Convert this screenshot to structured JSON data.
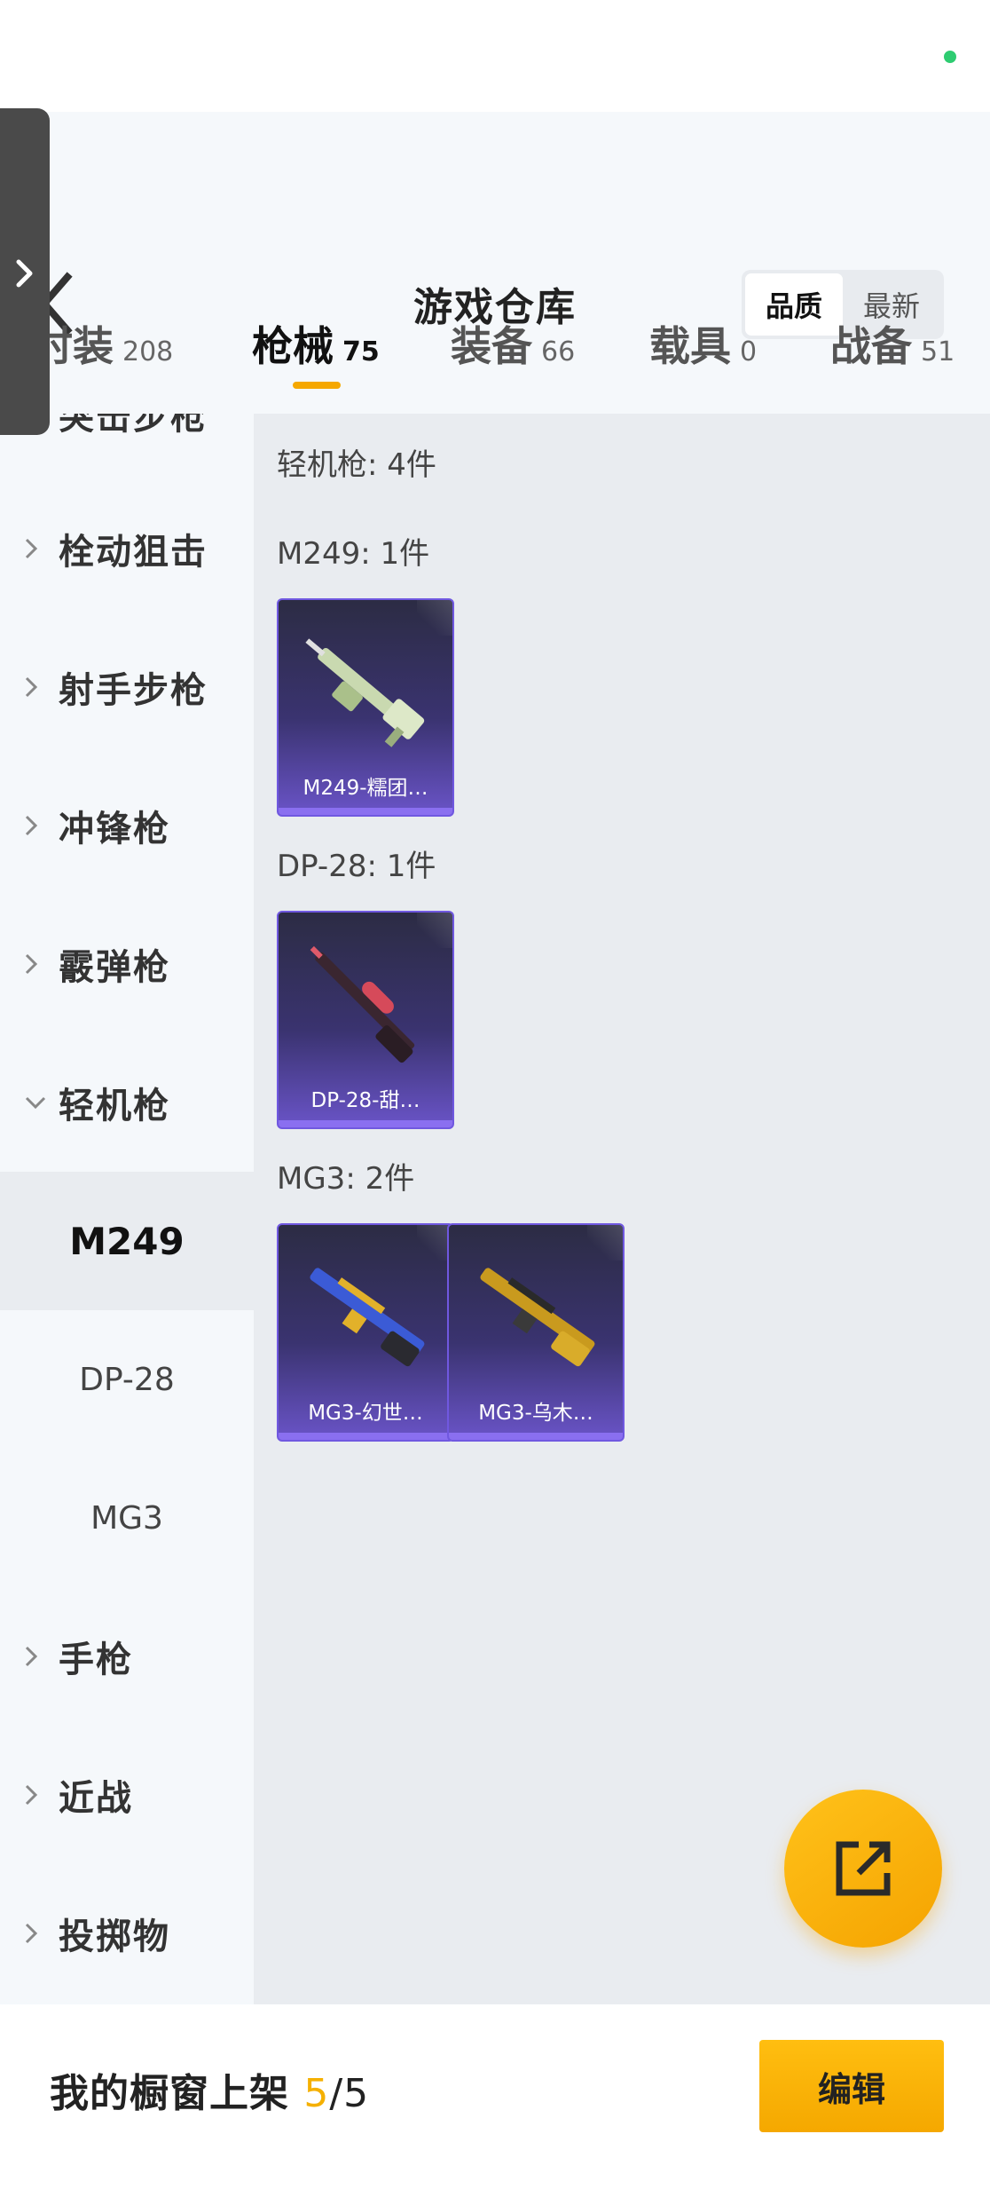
{
  "header": {
    "title": "游戏仓库",
    "sort_options": [
      "品质",
      "最新"
    ],
    "sort_selected": "品质"
  },
  "tabs": [
    {
      "label": "时装",
      "count": "208"
    },
    {
      "label": "枪械",
      "count": "75"
    },
    {
      "label": "装备",
      "count": "66"
    },
    {
      "label": "载具",
      "count": "0"
    },
    {
      "label": "战备",
      "count": "51"
    }
  ],
  "active_tab": "枪械",
  "sidebar": {
    "categories": [
      {
        "label": "突击步枪"
      },
      {
        "label": "栓动狙击"
      },
      {
        "label": "射手步枪"
      },
      {
        "label": "冲锋枪"
      },
      {
        "label": "霰弹枪"
      },
      {
        "label": "轻机枪"
      },
      {
        "label": "手枪"
      },
      {
        "label": "近战"
      },
      {
        "label": "投掷物"
      }
    ],
    "subitems": [
      {
        "label": "M249"
      },
      {
        "label": "DP-28"
      },
      {
        "label": "MG3"
      }
    ],
    "selected_subitem": "M249"
  },
  "content": {
    "group_title": "轻机枪: 4件",
    "sections": [
      {
        "title": "M249: 1件",
        "items": [
          {
            "name": "M249-糯团…"
          }
        ]
      },
      {
        "title": "DP-28: 1件",
        "items": [
          {
            "name": "DP-28-甜…"
          }
        ]
      },
      {
        "title": "MG3: 2件",
        "items": [
          {
            "name": "MG3-幻世…"
          },
          {
            "name": "MG3-乌木…"
          }
        ]
      }
    ]
  },
  "bottom_bar": {
    "showcase_label": "我的橱窗上架",
    "count": "5",
    "separator": "/",
    "total": "5",
    "edit_label": "编辑"
  },
  "colors": {
    "accent": "#f5a800",
    "card_purple": "#6a54c8",
    "status_dot": "#2ecc71"
  },
  "icons": {
    "back": "back-arrow-icon",
    "expand": "chevron-right-icon",
    "collapse": "chevron-down-icon",
    "fab": "external-link-icon"
  }
}
